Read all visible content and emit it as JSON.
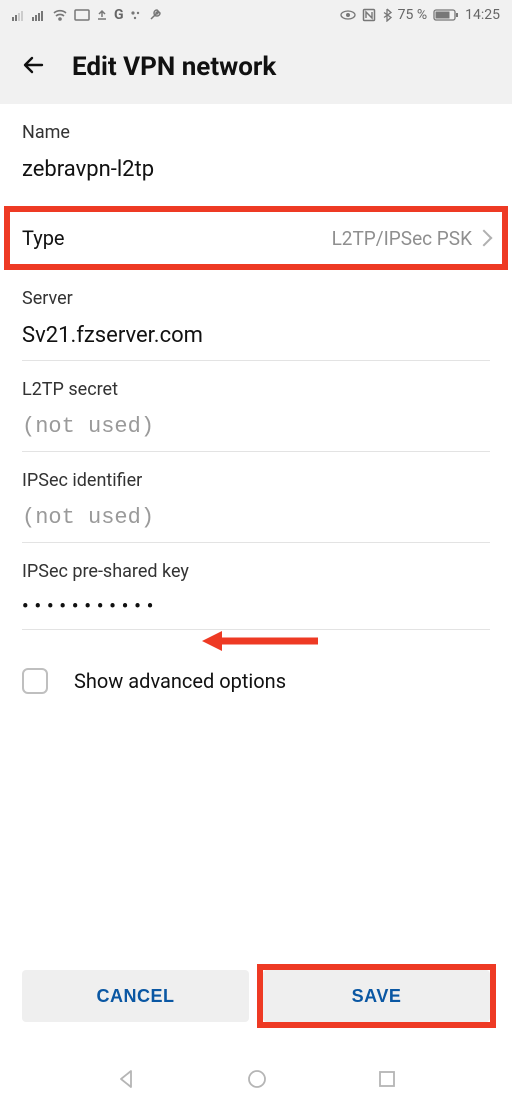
{
  "status": {
    "battery_pct": "75 %",
    "time": "14:25"
  },
  "header": {
    "title": "Edit VPN network"
  },
  "fields": {
    "name_label": "Name",
    "name_value": "zebravpn-l2tp",
    "type_label": "Type",
    "type_value": "L2TP/IPSec PSK",
    "server_label": "Server",
    "server_value": "Sv21.fzserver.com",
    "l2tp_label": "L2TP secret",
    "l2tp_placeholder": "(not used)",
    "ipsec_id_label": "IPSec identifier",
    "ipsec_id_placeholder": "(not used)",
    "psk_label": "IPSec pre-shared key",
    "psk_value": "•••••••••••",
    "show_advanced": "Show advanced options"
  },
  "buttons": {
    "cancel": "CANCEL",
    "save": "SAVE"
  }
}
